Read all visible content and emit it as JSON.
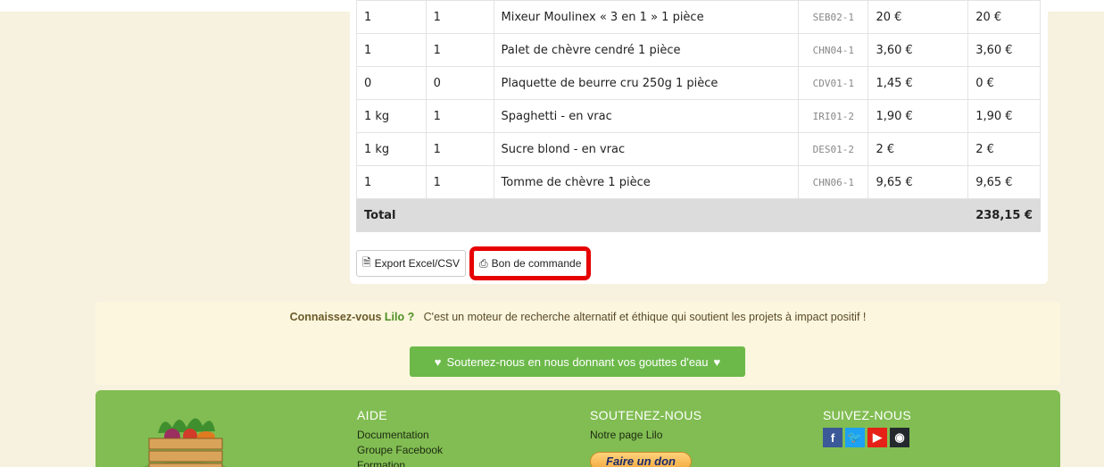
{
  "table": {
    "rows": [
      {
        "qty": "1",
        "received": "1",
        "product": "Mixeur Moulinex « 3 en 1 » 1 pièce",
        "code": "SEB02-1",
        "unit_price": "20 €",
        "total": "20 €"
      },
      {
        "qty": "1",
        "received": "1",
        "product": "Palet de chèvre cendré 1 pièce",
        "code": "CHN04-1",
        "unit_price": "3,60 €",
        "total": "3,60 €"
      },
      {
        "qty": "0",
        "received": "0",
        "product": "Plaquette de beurre cru 250g 1 pièce",
        "code": "CDV01-1",
        "unit_price": "1,45 €",
        "total": "0 €"
      },
      {
        "qty": "1 kg",
        "received": "1",
        "product": "Spaghetti - en vrac",
        "code": "IRI01-2",
        "unit_price": "1,90 €",
        "total": "1,90 €"
      },
      {
        "qty": "1 kg",
        "received": "1",
        "product": "Sucre blond - en vrac",
        "code": "DES01-2",
        "unit_price": "2 €",
        "total": "2 €"
      },
      {
        "qty": "1",
        "received": "1",
        "product": "Tomme de chèvre 1 pièce",
        "code": "CHN06-1",
        "unit_price": "9,65 €",
        "total": "9,65 €"
      }
    ],
    "total_label": "Total",
    "total_value": "238,15 €"
  },
  "actions": {
    "export_label": "Export Excel/CSV",
    "order_label": "Bon de commande"
  },
  "lilo": {
    "prefix": "Connaissez-vous",
    "link": "Lilo ?",
    "text": "C'est un moteur de recherche alternatif et éthique qui soutient les projets à impact positif !",
    "button_label": "Soutenez-nous en nous donnant vos gouttes d'eau"
  },
  "footer": {
    "help_title": "AIDE",
    "help_links": [
      "Documentation",
      "Groupe Facebook",
      "Formation"
    ],
    "support_title": "SOUTENEZ-NOUS",
    "support_link": "Notre page Lilo",
    "donate_label": "Faire un don",
    "follow_title": "SUIVEZ-NOUS",
    "social": [
      {
        "icon": "facebook-icon",
        "glyph": "f",
        "color": "#3b5998"
      },
      {
        "icon": "twitter-icon",
        "glyph": "🐦",
        "color": "#1da1f2"
      },
      {
        "icon": "youtube-icon",
        "glyph": "▶",
        "color": "#e62117"
      },
      {
        "icon": "github-icon",
        "glyph": "◉",
        "color": "#24292e"
      }
    ]
  },
  "colors": {
    "accent": "#6cb94a",
    "highlight": "#e60000",
    "footer_bg": "#81bd52"
  }
}
